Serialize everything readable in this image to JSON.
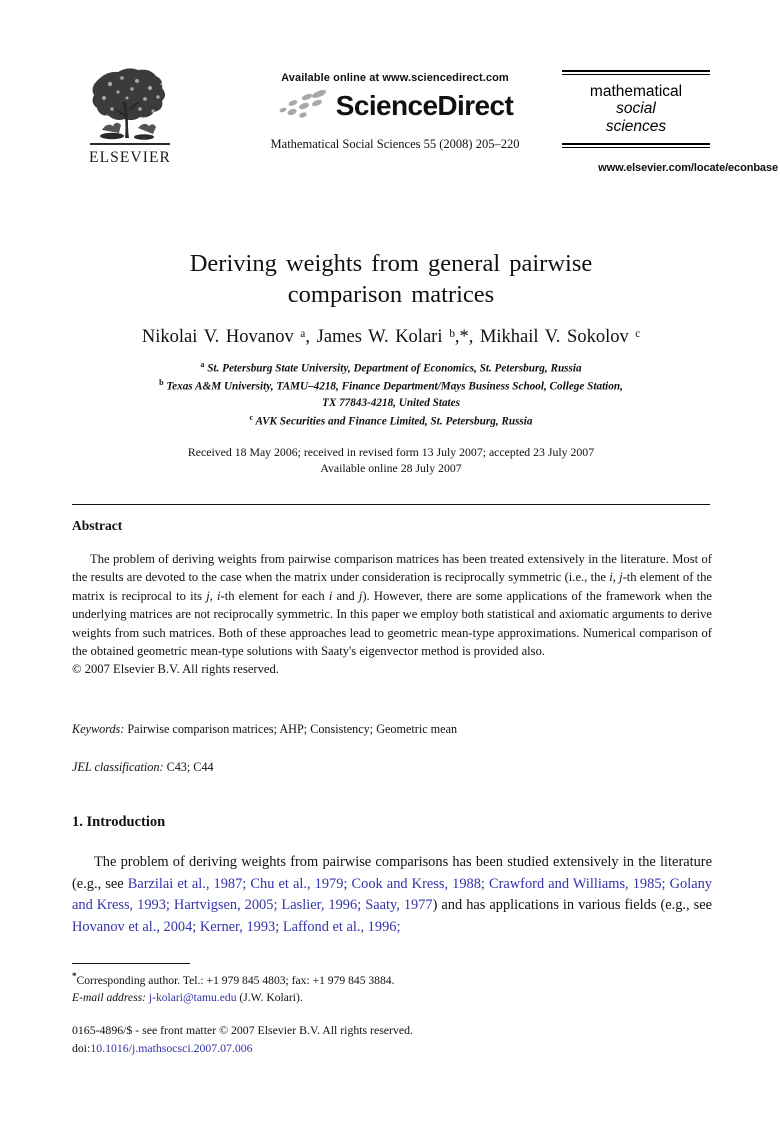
{
  "masthead": {
    "publisher_name": "ELSEVIER",
    "available_online": "Available online at www.sciencedirect.com",
    "sciencedirect_wordmark": "ScienceDirect",
    "journal_reference": "Mathematical Social Sciences 55 (2008) 205–220",
    "journal_logo": {
      "line1": "mathematical",
      "line2": "social",
      "line3": "sciences"
    },
    "elsevier_url": "www.elsevier.com/locate/econbase"
  },
  "article": {
    "title_line1": "Deriving weights from general pairwise",
    "title_line2": "comparison matrices",
    "authors": "Nikolai V. Hovanov ᵃ, James W. Kolari ᵇ,*, Mikhail V. Sokolov ᶜ",
    "affiliations": [
      "ᵃ St. Petersburg State University, Department of Economics, St. Petersburg, Russia",
      "ᵇ Texas A&M University, TAMU–4218, Finance Department/Mays Business School, College Station, TX 77843-4218, United States",
      "ᶜ AVK Securities and Finance Limited, St. Petersburg, Russia"
    ],
    "affiliation_a_marker": "a",
    "affiliation_a_text": "St. Petersburg State University, Department of Economics, St. Petersburg, Russia",
    "affiliation_b_marker": "b",
    "affiliation_b_text_line1": "Texas A&M University, TAMU–4218, Finance Department/Mays Business School, College Station,",
    "affiliation_b_text_line2": "TX 77843-4218, United States",
    "affiliation_c_marker": "c",
    "affiliation_c_text": "AVK Securities and Finance Limited, St. Petersburg, Russia",
    "dates_line1": "Received 18 May 2006; received in revised form 13 July 2007; accepted 23 July 2007",
    "dates_line2": "Available online 28 July 2007"
  },
  "abstract": {
    "heading": "Abstract",
    "text_part1": "The problem of deriving weights from pairwise comparison matrices has been treated extensively in the literature. Most of the results are devoted to the case when the matrix under consideration is reciprocally symmetric (i.e., the ",
    "text_italic1": "i",
    "text_part2": ", ",
    "text_italic2": "j",
    "text_part3": "-th element of the matrix is reciprocal to its ",
    "text_italic3": "j",
    "text_part4": ", ",
    "text_italic4": "i",
    "text_part5": "-th element for each ",
    "text_italic5": "i",
    "text_part6": " and ",
    "text_italic6": "j",
    "text_part7": "). However, there are some applications of the framework when the underlying matrices are not reciprocally symmetric. In this paper we employ both statistical and axiomatic arguments to derive weights from such matrices. Both of these approaches lead to geometric mean-type approximations. Numerical comparison of the obtained geometric mean-type solutions with Saaty's eigenvector method is provided also.",
    "copyright": "© 2007 Elsevier B.V. All rights reserved."
  },
  "keywords": {
    "label": "Keywords:",
    "value": "Pairwise comparison matrices; AHP; Consistency; Geometric mean"
  },
  "jel": {
    "label": "JEL classification:",
    "value": "C43; C44"
  },
  "introduction": {
    "heading": "1. Introduction",
    "text_lead": "The problem of deriving weights from pairwise comparisons has been studied extensively in the literature (e.g., see ",
    "citations_1": "Barzilai et al., 1987; Chu et al., 1979; Cook and Kress, 1988; Crawford and Williams, 1985; Golany and Kress, 1993; Hartvigsen, 2005; Laslier, 1996; Saaty, 1977",
    "text_mid": ") and has applications in various fields (e.g., see ",
    "citations_2": "Hovanov et al., 2004; Kerner, 1993; Laffond et al., 1996;"
  },
  "footnote": {
    "corresponding_marker": "*",
    "corresponding_text": "Corresponding author. Tel.: +1 979 845 4803; fax: +1 979 845 3884.",
    "email_label": "E-mail address:",
    "email": "j-kolari@tamu.edu",
    "email_owner": "(J.W. Kolari)."
  },
  "footer": {
    "issn_line": "0165-4896/$ - see front matter © 2007 Elsevier B.V. All rights reserved.",
    "doi_label": "doi:",
    "doi_value": "10.1016/j.mathsocsci.2007.07.006"
  },
  "colors": {
    "link_blue": "#3333aa",
    "text_black": "#111111",
    "swoosh_gray": "#a0a0a0"
  }
}
